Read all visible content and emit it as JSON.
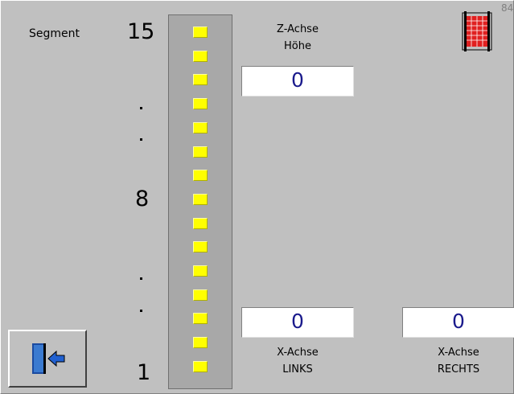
{
  "segment_label": "Segment",
  "scale": {
    "top": "15",
    "middle": "8",
    "bottom": "1"
  },
  "segments": {
    "count": 15,
    "color": "#ffff00"
  },
  "z_axis": {
    "caption_line1": "Z-Achse",
    "caption_line2": "Höhe",
    "value": "0"
  },
  "x_left": {
    "value": "0",
    "caption_line1": "X-Achse",
    "caption_line2": "LINKS"
  },
  "x_right": {
    "value": "0",
    "caption_line1": "X-Achse",
    "caption_line2": "RECHTS"
  },
  "corner": {
    "number": "84",
    "icon": "grid-rack-icon"
  },
  "exit_button": {
    "icon": "exit-door-icon"
  },
  "colors": {
    "background": "#c0c0c0",
    "value_text": "#1a1a8c",
    "rack_icon": "#e02020"
  }
}
